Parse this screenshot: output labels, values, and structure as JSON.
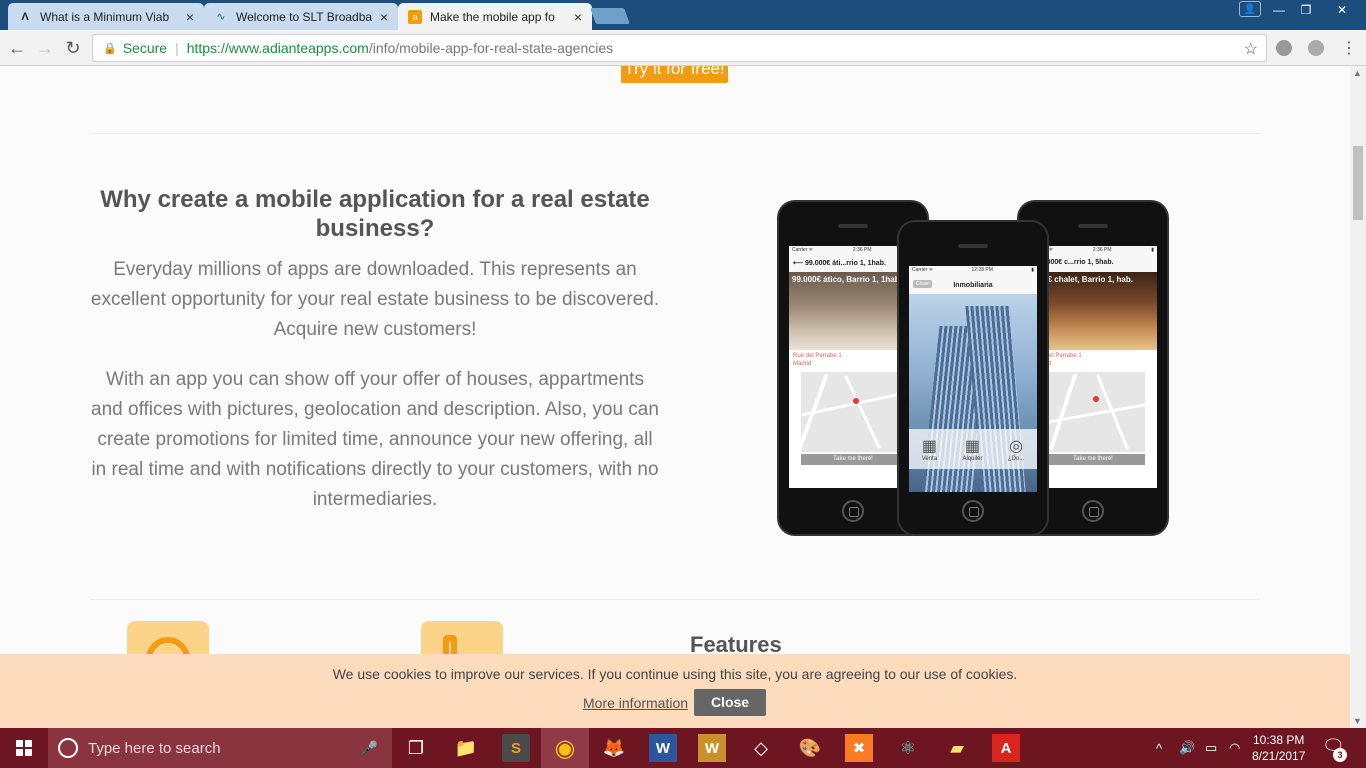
{
  "browser": {
    "tabs": [
      {
        "title": "What is a Minimum Viab",
        "icon": "a-logo-icon"
      },
      {
        "title": "Welcome to SLT Broadba",
        "icon": "slt-icon"
      },
      {
        "title": "Make the mobile app fo",
        "icon": "adiante-icon",
        "active": true
      }
    ],
    "close_glyph": "×",
    "profile_glyph": "👤",
    "window_controls": {
      "minimize": "—",
      "restore": "❐",
      "close": "✕"
    },
    "security_label": "Secure",
    "url_host": "https://www.adianteapps.com",
    "url_path": "/info/mobile-app-for-real-state-agencies",
    "star_glyph": "☆"
  },
  "page": {
    "try_button": "Try it for free!",
    "heading": "Why create a mobile application for a real estate business?",
    "paragraph1": "Everyday millions of apps are downloaded. This represents an excellent opportunity for your real estate business to be discovered. Acquire new customers!",
    "paragraph2": "With an app you can show off your offer of houses, appartments and offices with pictures, geolocation and description. Also, you can create promotions for limited time, announce your new offering, all in real time and with notifications directly to your customers, with no intermediaries.",
    "features_title": "Features"
  },
  "phones": {
    "left": {
      "carrier": "Carrier ᯤ",
      "time": "2:36 PM",
      "header": "⟵  99.000€ áti...rrio 1, 1hab.",
      "photo_label": "99.000€ ático, Barrio 1, 1hab.",
      "address": "Rue del Perrabe 1\nMadrid",
      "take_me": "Take me there!"
    },
    "center": {
      "carrier": "Carrier ᯤ",
      "time": "12:28 PM",
      "close": "Close",
      "app_title": "Inmobiliaria",
      "menu": [
        {
          "glyph": "▦",
          "label": "Venta"
        },
        {
          "glyph": "▦",
          "label": "Alquiler"
        },
        {
          "glyph": "◎",
          "label": "¿Do..."
        }
      ]
    },
    "right": {
      "carrier": "Carrier ᯤ",
      "time": "2:36 PM",
      "header": "199.000€ c...rrio 1, 5hab.",
      "photo_label": ".000€ chalet, Barrio 1, hab.",
      "address": "Rue del Perrabe 1\nMadrid",
      "take_me": "Take me there!"
    }
  },
  "cookie": {
    "text": "We use cookies to improve our services. If you continue using this site, you are agreeing to our use of cookies.",
    "more": "More information",
    "close": "Close"
  },
  "scrollbar": {
    "up": "▲",
    "down": "▼"
  },
  "taskbar": {
    "search_placeholder": "Type here to search",
    "mic_glyph": "🎤",
    "apps": [
      {
        "name": "task-view",
        "glyph": "❐"
      },
      {
        "name": "file-explorer",
        "glyph": "📁"
      },
      {
        "name": "sublime",
        "glyph": "S"
      },
      {
        "name": "chrome",
        "glyph": "◉"
      },
      {
        "name": "firefox",
        "glyph": "🦊"
      },
      {
        "name": "word",
        "glyph": "W"
      },
      {
        "name": "word-2",
        "glyph": "W"
      },
      {
        "name": "unity",
        "glyph": "◇"
      },
      {
        "name": "paint",
        "glyph": "🎨"
      },
      {
        "name": "xampp",
        "glyph": "✖"
      },
      {
        "name": "atom",
        "glyph": "⚛"
      },
      {
        "name": "sticky-notes",
        "glyph": "▰"
      },
      {
        "name": "acrobat",
        "glyph": "A"
      }
    ],
    "tray": {
      "chevron": "^",
      "volume": "🔊",
      "battery": "▭",
      "wifi": "◠"
    },
    "time": "10:38 PM",
    "date": "8/21/2017",
    "notification_glyph": "🗨",
    "notification_count": "3"
  }
}
